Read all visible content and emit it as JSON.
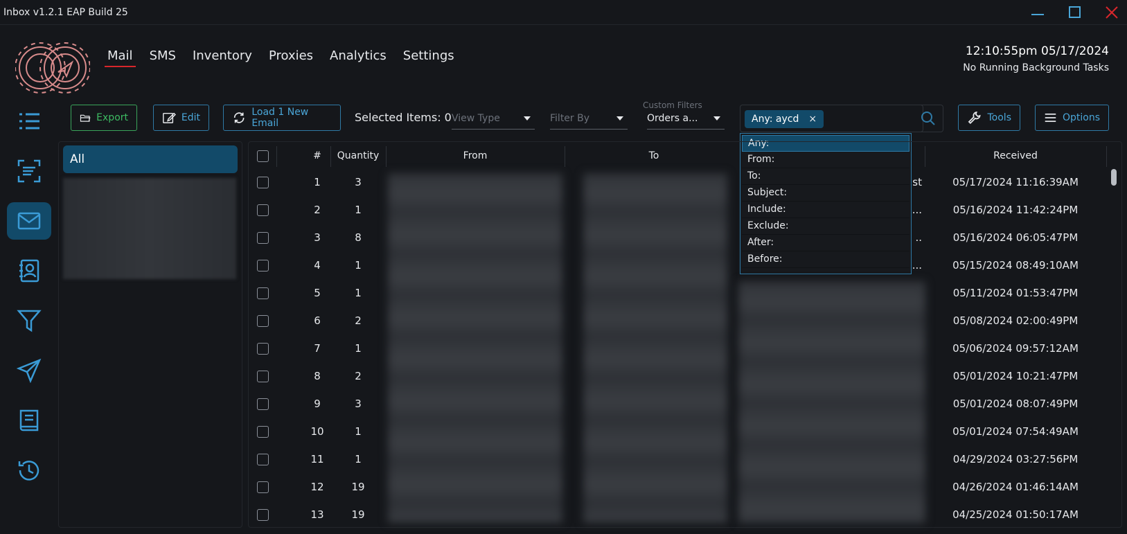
{
  "window": {
    "title": "Inbox v1.2.1 EAP Build 25",
    "minimize_icon": "minimize-icon",
    "maximize_icon": "maximize-icon",
    "close_icon": "close-icon"
  },
  "nav": {
    "items": [
      "Mail",
      "SMS",
      "Inventory",
      "Proxies",
      "Analytics",
      "Settings"
    ],
    "active": "Mail"
  },
  "clock": {
    "time": "12:10:55pm 05/17/2024",
    "status": "No Running Background Tasks"
  },
  "sidebar": {
    "icons": [
      "list-icon",
      "scan-text-icon",
      "mail-icon",
      "contacts-icon",
      "filter-icon",
      "send-icon",
      "book-icon",
      "history-icon"
    ],
    "active": "mail-icon"
  },
  "toolbar": {
    "export_label": "Export",
    "edit_label": "Edit",
    "load_label": "Load 1 New Email",
    "selected_items": "Selected Items: 0",
    "view_type_placeholder": "View Type",
    "filter_by_placeholder": "Filter By",
    "custom_filters_label": "Custom Filters",
    "custom_filters_value": "Orders a...",
    "tools_label": "Tools",
    "options_label": "Options"
  },
  "search": {
    "chip": "Any: aycd",
    "chip_remove": "×",
    "suggestions": [
      "Any:",
      "From:",
      "To:",
      "Subject:",
      "Include:",
      "Exclude:",
      "After:",
      "Before:"
    ],
    "highlighted": "Any:"
  },
  "folders": {
    "all_label": "All"
  },
  "table": {
    "headers": {
      "num": "#",
      "quantity": "Quantity",
      "from": "From",
      "to": "To",
      "received": "Received"
    },
    "rows": [
      {
        "num": "1",
        "qty": "3",
        "subject_tail": "st",
        "received": "05/17/2024 11:16:39AM"
      },
      {
        "num": "2",
        "qty": "1",
        "subject_tail": "...",
        "received": "05/16/2024 11:42:24PM"
      },
      {
        "num": "3",
        "qty": "8",
        "subject_tail": "..",
        "received": "05/16/2024 06:05:47PM"
      },
      {
        "num": "4",
        "qty": "1",
        "subject_tail": "...",
        "received": "05/15/2024 08:49:10AM"
      },
      {
        "num": "5",
        "qty": "1",
        "subject_tail": "",
        "received": "05/11/2024 01:53:47PM"
      },
      {
        "num": "6",
        "qty": "2",
        "subject_tail": "",
        "received": "05/08/2024 02:00:49PM"
      },
      {
        "num": "7",
        "qty": "1",
        "subject_tail": "",
        "received": "05/06/2024 09:57:12AM"
      },
      {
        "num": "8",
        "qty": "2",
        "subject_tail": "",
        "received": "05/01/2024 10:21:47PM"
      },
      {
        "num": "9",
        "qty": "3",
        "subject_tail": "",
        "received": "05/01/2024 08:07:49PM"
      },
      {
        "num": "10",
        "qty": "1",
        "subject_tail": "",
        "received": "05/01/2024 07:54:49AM"
      },
      {
        "num": "11",
        "qty": "1",
        "subject_tail": "",
        "received": "04/29/2024 03:27:56PM"
      },
      {
        "num": "12",
        "qty": "19",
        "subject_tail": "",
        "received": "04/26/2024 01:46:14AM"
      },
      {
        "num": "13",
        "qty": "19",
        "subject_tail": "",
        "received": "04/25/2024 01:50:17AM"
      }
    ]
  },
  "colors": {
    "accent": "#124a69",
    "accent_border": "#2f7aa6",
    "nav_underline": "#d8262b",
    "export_green": "#3dbb62",
    "background": "#15171b"
  }
}
